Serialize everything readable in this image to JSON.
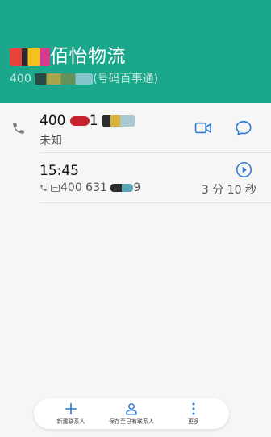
{
  "header": {
    "title": "佰怡物流",
    "subtitle_prefix": "400",
    "subtitle_source": "(号码百事通)"
  },
  "call_entry": {
    "number_prefix": "400",
    "number_mid": "1",
    "label": "未知"
  },
  "history": {
    "time": "15:45",
    "number": "400 631",
    "number_suffix": "9",
    "duration": "3 分 10 秒"
  },
  "bottom_actions": {
    "new_contact": "新建联系人",
    "save_to_existing": "保存至已有联系人",
    "more": "更多"
  },
  "colors": {
    "header_bg": "#1aa78c",
    "accent": "#2e7cd6"
  },
  "icons": [
    "phone-icon",
    "video-call-icon",
    "message-icon",
    "play-icon",
    "add-icon",
    "person-icon",
    "more-vertical-icon"
  ]
}
